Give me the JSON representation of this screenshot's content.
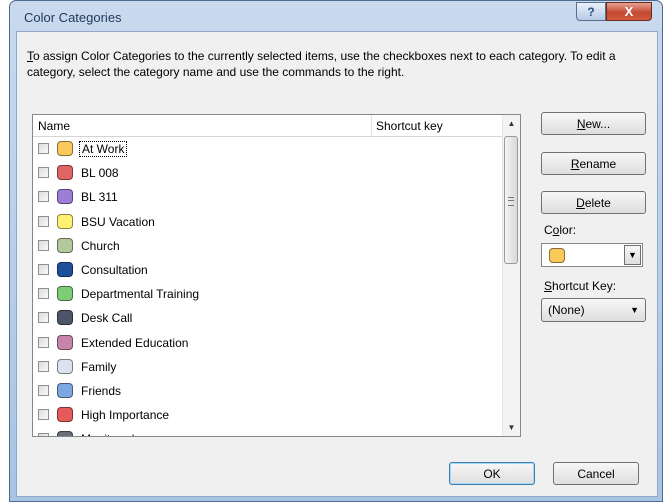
{
  "window": {
    "title": "Color Categories",
    "help_symbol": "?",
    "close_symbol": "X"
  },
  "instructions": {
    "first_letter": "T",
    "rest": "o assign Color Categories to the currently selected items, use the checkboxes next to each category.  To edit a category, select the category name and use the commands to the right."
  },
  "list": {
    "col_name": "Name",
    "col_shortcut": "Shortcut key",
    "items": [
      {
        "label": "At Work",
        "color": "#f9c95c",
        "checked": false,
        "selected": true
      },
      {
        "label": "BL 008",
        "color": "#e06666",
        "checked": false
      },
      {
        "label": "BL 311",
        "color": "#9b7fd6",
        "checked": false
      },
      {
        "label": "BSU Vacation",
        "color": "#fff272",
        "checked": false
      },
      {
        "label": "Church",
        "color": "#b3c99c",
        "checked": false
      },
      {
        "label": "Consultation",
        "color": "#1f4e9a",
        "checked": false
      },
      {
        "label": "Departmental Training",
        "color": "#7ccc78",
        "checked": false
      },
      {
        "label": "Desk Call",
        "color": "#4d5568",
        "checked": false
      },
      {
        "label": "Extended Education",
        "color": "#c786a9",
        "checked": false
      },
      {
        "label": "Family",
        "color": "#dde3ee",
        "checked": false
      },
      {
        "label": "Friends",
        "color": "#7da7e0",
        "checked": false
      },
      {
        "label": "High Importance",
        "color": "#e55a5a",
        "checked": false
      },
      {
        "label": "Monitored",
        "color": "#6a6f78",
        "checked": false
      }
    ]
  },
  "buttons": {
    "new_u": "N",
    "new_rest": "ew...",
    "rename_u": "R",
    "rename_rest": "ename",
    "delete_u": "D",
    "delete_rest": "elete",
    "ok": "OK",
    "cancel": "Cancel"
  },
  "color": {
    "label_pre": "C",
    "label_u": "o",
    "label_rest": "lor:",
    "value": "#f9c95c"
  },
  "shortcut": {
    "label_u": "S",
    "label_rest": "hortcut Key:",
    "value": "(None)"
  }
}
